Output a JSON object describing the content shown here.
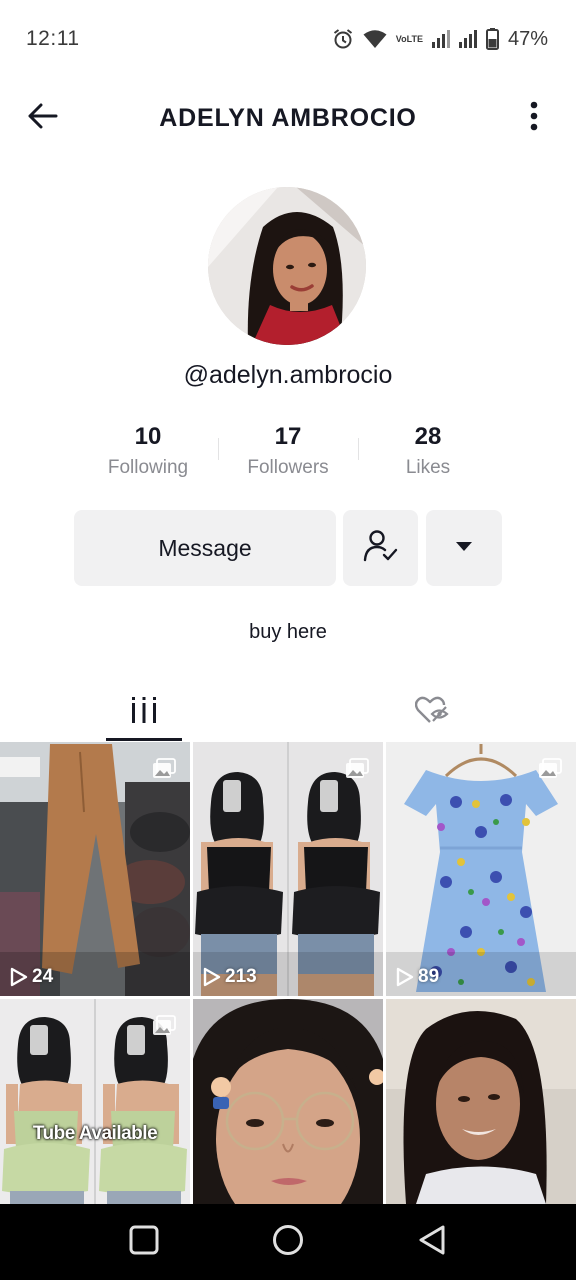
{
  "status_bar": {
    "time": "12:11",
    "network_label": "VoLTE",
    "battery_percent": "47%",
    "icons": [
      "alarm-icon",
      "wifi-icon",
      "volte-icon",
      "signal-icon",
      "signal-icon",
      "battery-icon"
    ]
  },
  "header": {
    "title": "ADELYN AMBROCIO",
    "back_icon": "arrow-left-icon",
    "more_icon": "more-vertical-icon"
  },
  "profile": {
    "avatar": "avatar",
    "username": "@adelyn.ambrocio",
    "bio": "buy here"
  },
  "stats": [
    {
      "value": "10",
      "label": "Following"
    },
    {
      "value": "17",
      "label": "Followers"
    },
    {
      "value": "28",
      "label": "Likes"
    }
  ],
  "actions": {
    "message_label": "Message",
    "follow_icon": "user-check-icon",
    "dropdown_icon": "caret-down-icon"
  },
  "tabs": [
    {
      "name": "videos",
      "icon": "grid-bars-icon",
      "active": true
    },
    {
      "name": "liked",
      "icon": "heart-hidden-icon",
      "active": false
    }
  ],
  "videos": [
    {
      "views": "24",
      "photo_post": true,
      "overlay": ""
    },
    {
      "views": "213",
      "photo_post": true,
      "overlay": ""
    },
    {
      "views": "89",
      "photo_post": true,
      "overlay": ""
    },
    {
      "views": "",
      "photo_post": true,
      "overlay": "Tube Available"
    },
    {
      "views": "",
      "photo_post": false,
      "overlay": ""
    },
    {
      "views": "",
      "photo_post": false,
      "overlay": ""
    }
  ],
  "nav_bar": {
    "recent_icon": "square-icon",
    "home_icon": "circle-icon",
    "back_icon": "triangle-back-icon"
  },
  "colors": {
    "text_primary": "#161823",
    "text_secondary": "#8a8b91",
    "button_bg": "#f1f1f2",
    "nav_bar": "#000000"
  }
}
